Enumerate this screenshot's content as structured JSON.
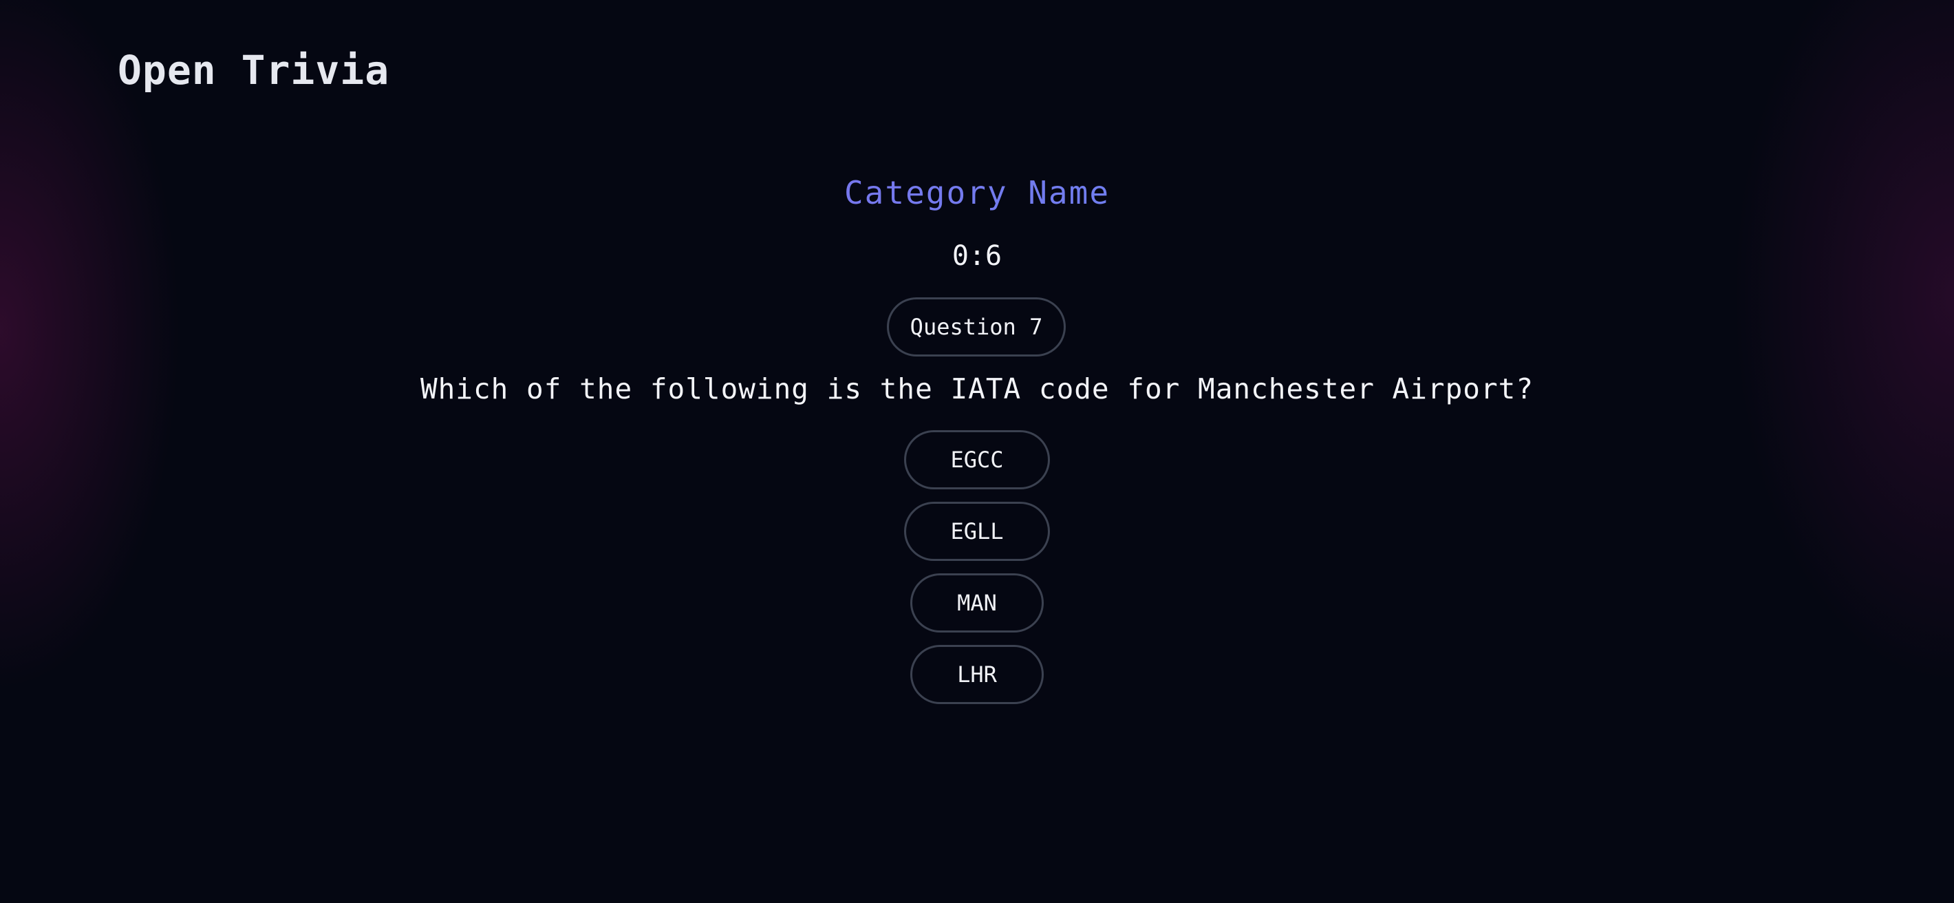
{
  "app": {
    "title": "Open Trivia"
  },
  "quiz": {
    "category": "Category Name",
    "score": "0:6",
    "question_label": "Question 7",
    "question": "Which of the following is the IATA code for Manchester Airport?",
    "answers": [
      {
        "label": "EGCC"
      },
      {
        "label": "EGLL"
      },
      {
        "label": "MAN"
      },
      {
        "label": "LHR"
      }
    ]
  },
  "colors": {
    "background": "#050712",
    "category_gradient_start": "#8b67e6",
    "category_gradient_end": "#5e86f0",
    "button_border": "#3b4150",
    "text": "#eef0f6"
  }
}
